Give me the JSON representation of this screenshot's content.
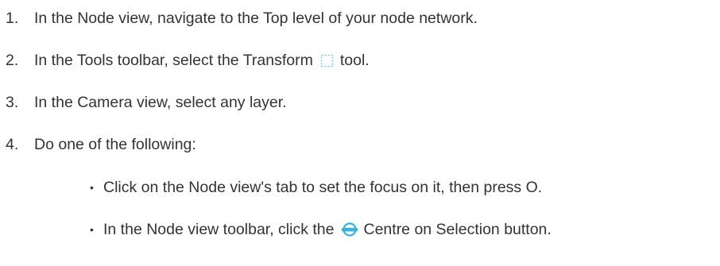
{
  "steps": [
    {
      "number": "1.",
      "text": "In the Node view, navigate to the Top level of your node network."
    },
    {
      "number": "2.",
      "text_before": "In the Tools toolbar, select the Transform",
      "icon": "transform-tool-icon",
      "text_after": "tool."
    },
    {
      "number": "3.",
      "text": "In the Camera view, select any layer."
    },
    {
      "number": "4.",
      "text": "Do one of the following:"
    }
  ],
  "bullets": [
    {
      "marker": "•",
      "text": "Click on the Node view's tab to set the focus on it, then press O."
    },
    {
      "marker": "•",
      "text_before": "In the Node view toolbar, click the",
      "icon": "centre-on-selection-icon",
      "text_after": "Centre on Selection button."
    }
  ],
  "colors": {
    "text": "#333333",
    "transform_icon": "#7ed3e8",
    "centre_icon": "#35b6d9"
  }
}
